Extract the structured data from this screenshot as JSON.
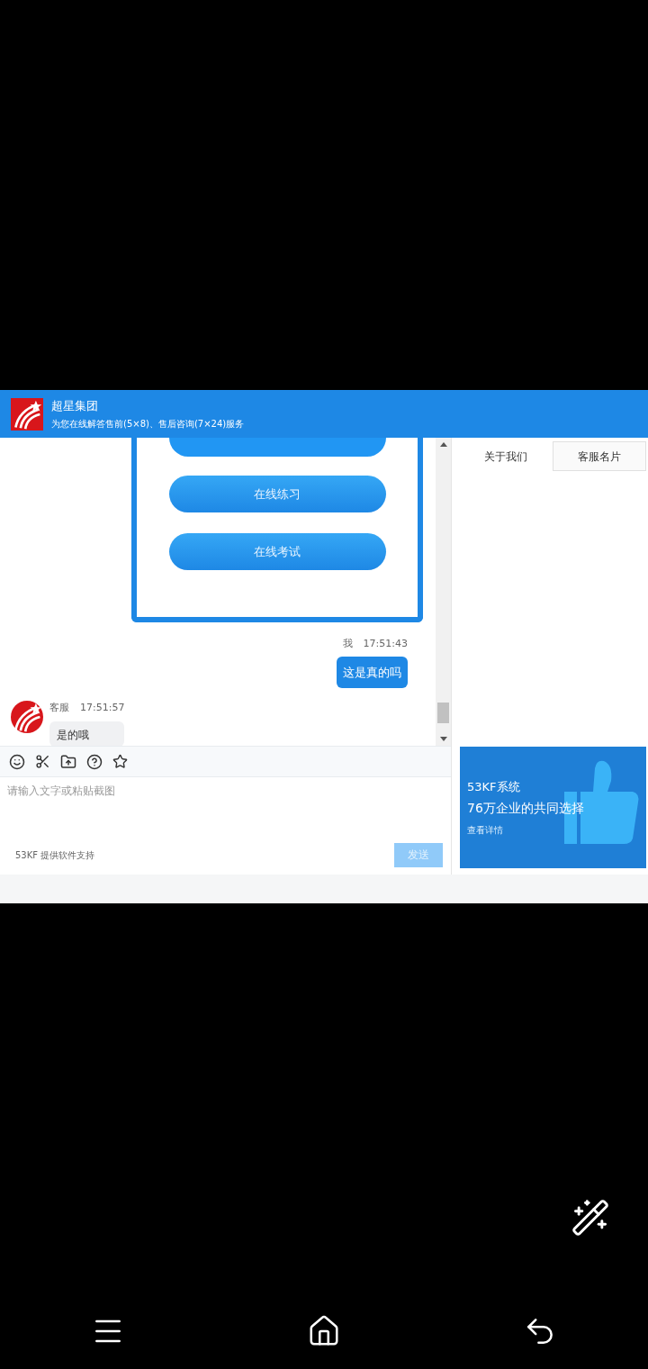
{
  "header": {
    "title": "超星集团",
    "subtitle": "为您在线解答售前(5×8)、售后咨询(7×24)服务"
  },
  "chat": {
    "image_buttons": [
      "在线练习",
      "在线考试"
    ],
    "messages": [
      {
        "kind": "sent",
        "sender": "我",
        "time": "17:51:43",
        "text": "这是真的吗"
      },
      {
        "kind": "received",
        "sender": "客服",
        "time": "17:51:57",
        "text": "是的哦"
      }
    ]
  },
  "tabs": [
    {
      "label": "关于我们",
      "selected": true
    },
    {
      "label": "客服名片",
      "selected": false
    }
  ],
  "composer": {
    "placeholder": "请输入文字或粘贴截图",
    "footer": "53KF 提供软件支持",
    "send": {
      "label": "发送",
      "disabled": true
    }
  },
  "ad": {
    "title": "53KF系统",
    "headline": "76万企业的共同选择",
    "link": "查看详情"
  }
}
